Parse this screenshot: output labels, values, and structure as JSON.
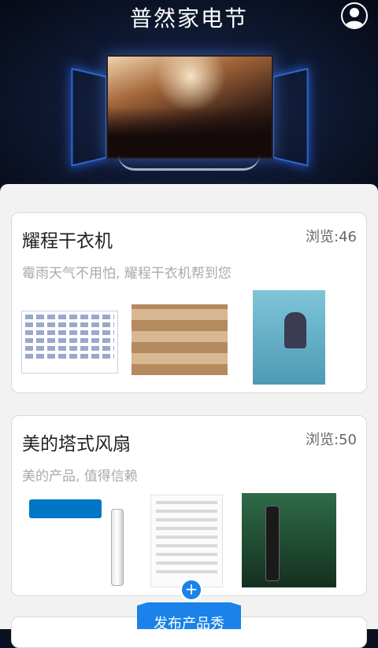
{
  "header": {
    "title": "普然家电节",
    "avatar_icon": "user-icon"
  },
  "cards": [
    {
      "title": "耀程干衣机",
      "views": "浏览:46",
      "description": "霉雨天气不用怕, 耀程干衣机帮到您"
    },
    {
      "title": "美的塔式风扇",
      "views": "浏览:50",
      "description": "美的产品, 值得信赖"
    }
  ],
  "publish": {
    "label": "发布产品秀",
    "icon": "plus-icon",
    "color": "#1a82e8"
  }
}
